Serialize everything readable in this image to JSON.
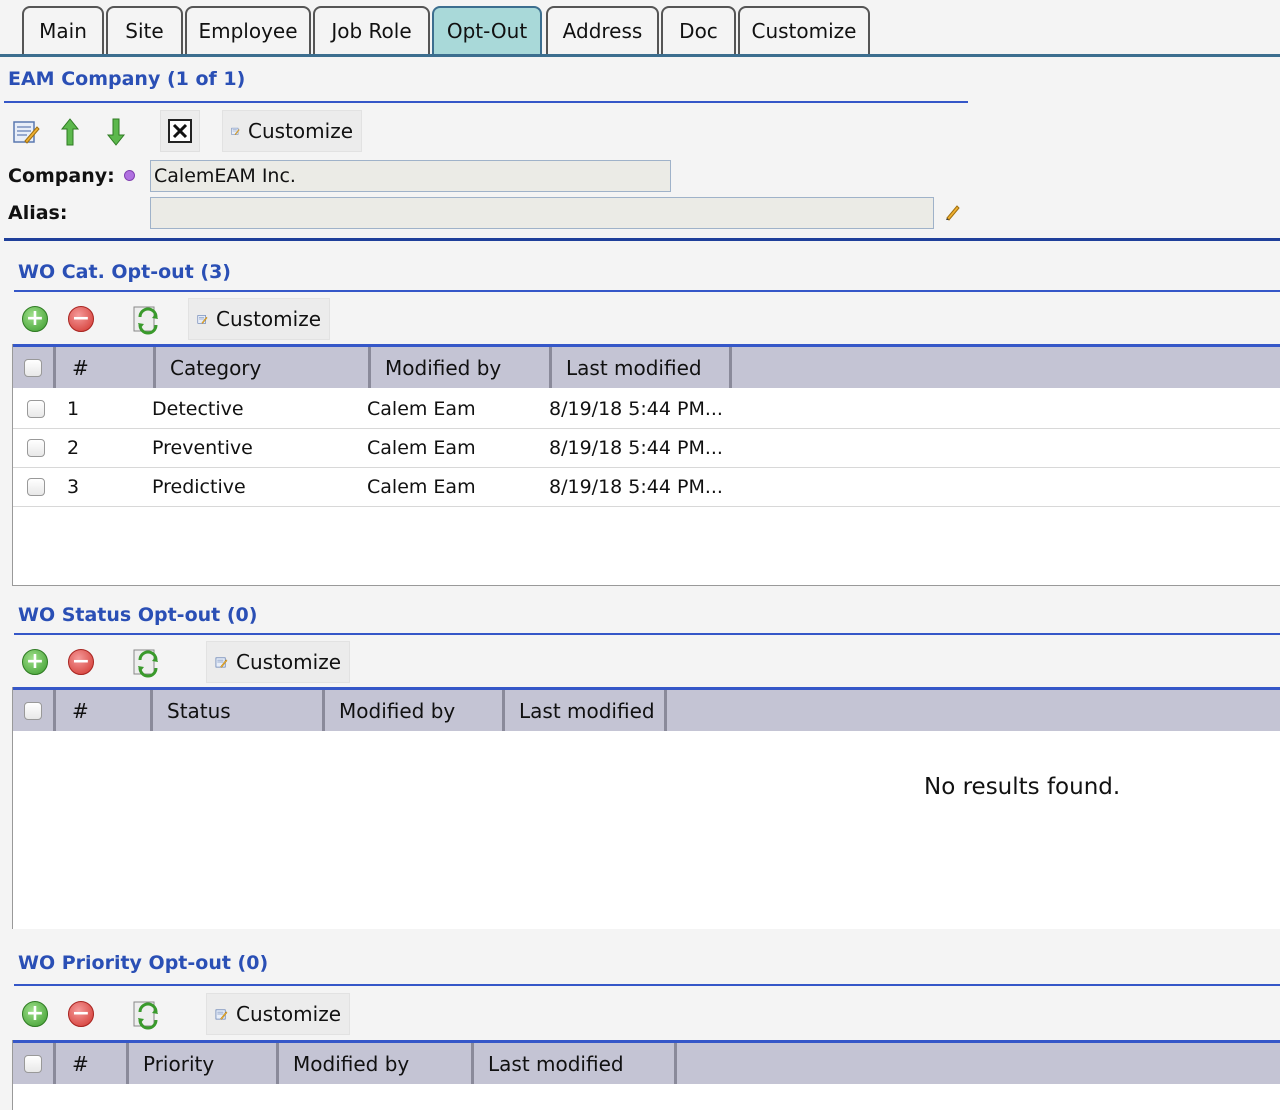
{
  "tabs": [
    {
      "label": "Main"
    },
    {
      "label": "Site"
    },
    {
      "label": "Employee"
    },
    {
      "label": "Job Role"
    },
    {
      "label": "Opt-Out"
    },
    {
      "label": "Address"
    },
    {
      "label": "Doc"
    },
    {
      "label": "Customize"
    }
  ],
  "active_tab": "Opt-Out",
  "company_section": {
    "title": "EAM Company (1 of 1)",
    "customize_label": "Customize",
    "company_label": "Company:",
    "company_value": "CalemEAM Inc.",
    "alias_label": "Alias:",
    "alias_value": ""
  },
  "wo_cat": {
    "title": "WO Cat. Opt-out (3)",
    "customize_label": "Customize",
    "columns": [
      "#",
      "Category",
      "Modified by",
      "Last modified"
    ],
    "rows": [
      {
        "num": "1",
        "category": "Detective",
        "modified_by": "Calem Eam",
        "last_modified": "8/19/18 5:44 PM..."
      },
      {
        "num": "2",
        "category": "Preventive",
        "modified_by": "Calem Eam",
        "last_modified": "8/19/18 5:44 PM..."
      },
      {
        "num": "3",
        "category": "Predictive",
        "modified_by": "Calem Eam",
        "last_modified": "8/19/18 5:44 PM..."
      }
    ]
  },
  "wo_status": {
    "title": "WO Status Opt-out (0)",
    "customize_label": "Customize",
    "columns": [
      "#",
      "Status",
      "Modified by",
      "Last modified"
    ],
    "empty_text": "No results found."
  },
  "wo_priority": {
    "title": "WO Priority Opt-out (0)",
    "customize_label": "Customize",
    "columns": [
      "#",
      "Priority",
      "Modified by",
      "Last modified"
    ]
  },
  "colors": {
    "accent_blue": "#2a4fb5",
    "active_tab": "#a9d9d9",
    "grid_header": "#c4c4d4"
  }
}
